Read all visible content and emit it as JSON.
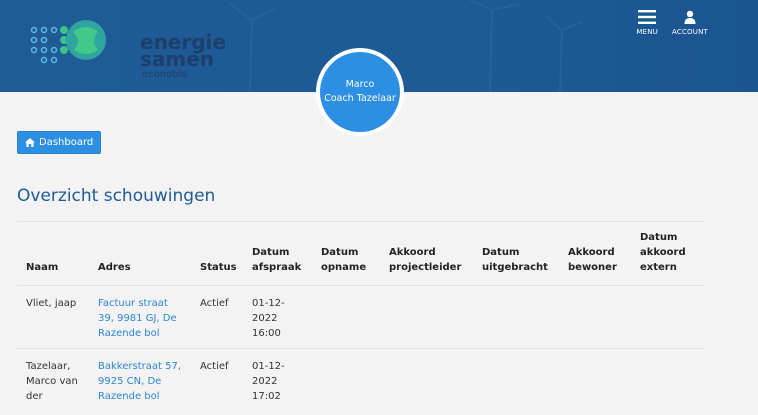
{
  "header": {
    "logo": {
      "line1": "energie",
      "line2": "samen",
      "line3": "econobis"
    },
    "menu_label": "MENU",
    "account_label": "ACCOUNT"
  },
  "coach": {
    "name": "Marco",
    "role": "Coach Tazelaar"
  },
  "dashboard_button": "Dashboard",
  "page_title": "Overzicht schouwingen",
  "table": {
    "headers": [
      [
        "Naam"
      ],
      [
        "Adres"
      ],
      [
        "Status"
      ],
      [
        "Datum",
        "afspraak"
      ],
      [
        "Datum",
        "opname"
      ],
      [
        "Akkoord",
        "projectleider"
      ],
      [
        "Datum",
        "uitgebracht"
      ],
      [
        "Akkoord",
        "bewoner"
      ],
      [
        "Datum",
        "akkoord",
        "extern"
      ]
    ],
    "rows": [
      {
        "naam": [
          "Vliet, jaap"
        ],
        "adres": [
          "Factuur straat",
          "39, 9981 GJ, De",
          "Razende bol"
        ],
        "status": "Actief",
        "datum_afspraak": [
          "01-12-",
          "2022",
          "16:00"
        ]
      },
      {
        "naam": [
          "Tazelaar,",
          "Marco van",
          "der"
        ],
        "adres": [
          "Bakkerstraat 57,",
          "9925 CN, De",
          "Razende bol"
        ],
        "status": "Actief",
        "datum_afspraak": [
          "01-12-",
          "2022",
          "17:02"
        ]
      }
    ]
  },
  "colors": {
    "header_blue": "#1d5a96",
    "accent": "#2d8fe3",
    "link": "#2d85d6",
    "title": "#1e5a96",
    "logo_green": "#35c48a",
    "logo_teal": "#2aa6a0"
  },
  "icons": {
    "menu": "hamburger-icon",
    "account": "user-icon",
    "dashboard": "home-icon"
  }
}
